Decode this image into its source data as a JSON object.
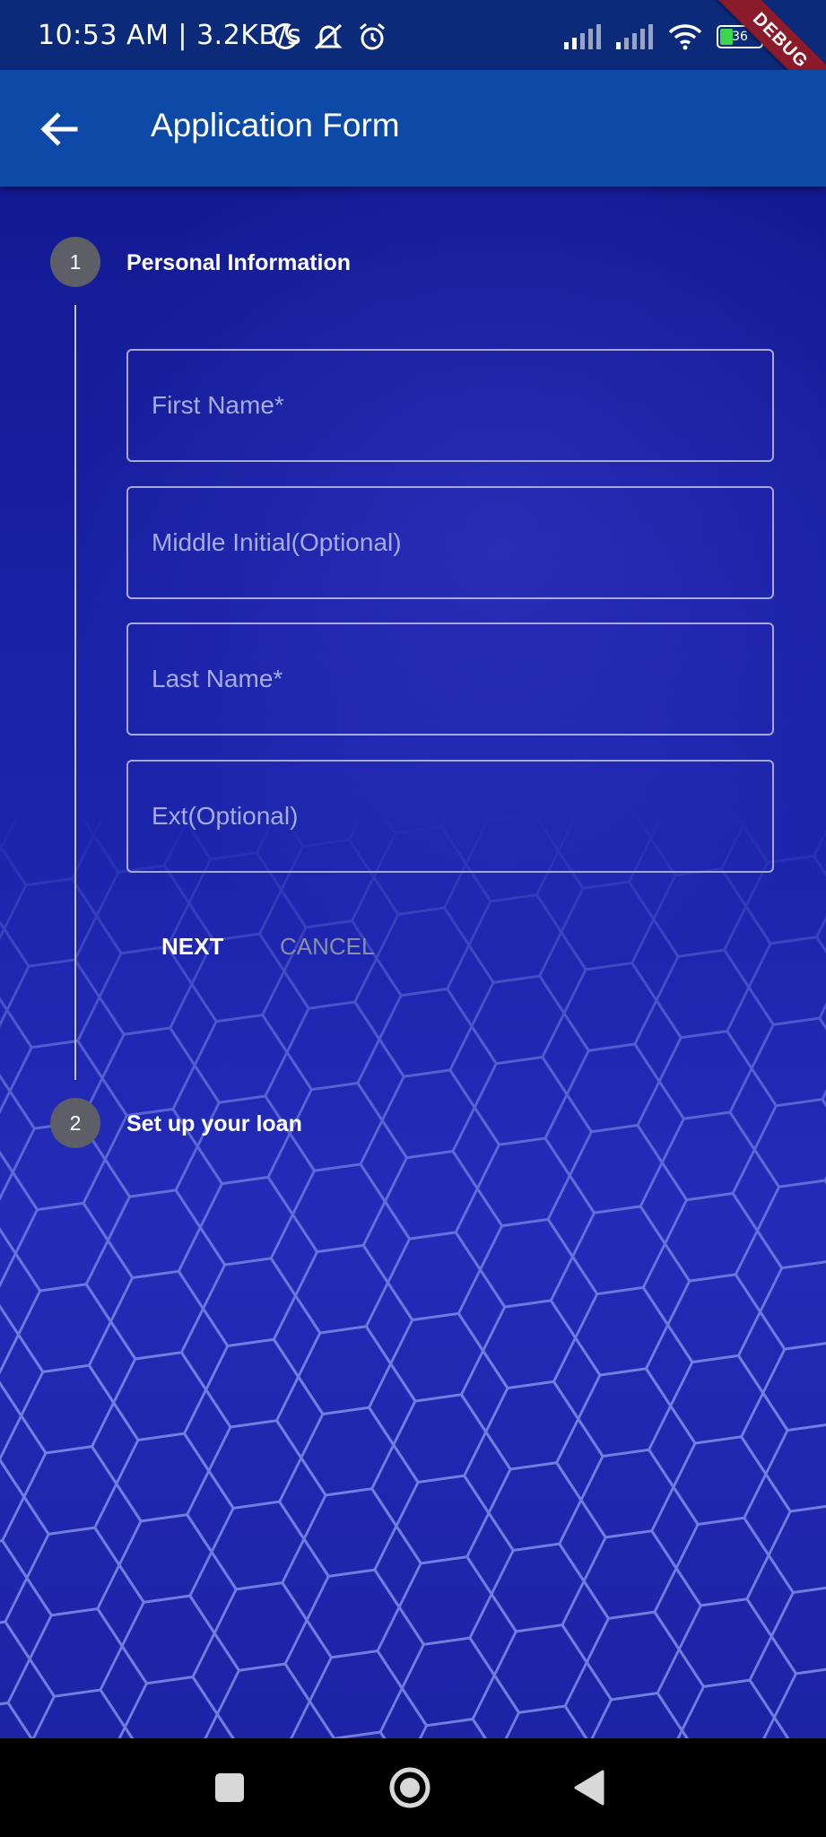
{
  "status_bar": {
    "time": "10:53 AM | 3.2KB/s",
    "battery_level": "36",
    "debug_label": "DEBUG",
    "icons": [
      "moon-icon",
      "mute-icon",
      "alarm-icon",
      "signal-icon",
      "signal-icon",
      "wifi-icon",
      "battery-icon"
    ]
  },
  "app_bar": {
    "title": "Application Form",
    "back_icon": "arrow-left-icon"
  },
  "stepper": {
    "steps": [
      {
        "number": "1",
        "title": "Personal Information"
      },
      {
        "number": "2",
        "title": "Set up your loan"
      }
    ],
    "fields": [
      {
        "placeholder": "First Name*",
        "value": ""
      },
      {
        "placeholder": "Middle Initial(Optional)",
        "value": ""
      },
      {
        "placeholder": "Last Name*",
        "value": ""
      },
      {
        "placeholder": "Ext(Optional)",
        "value": ""
      }
    ],
    "next_label": "NEXT",
    "cancel_label": "CANCEL"
  },
  "nav_bar": {
    "icons": [
      "square-recents-icon",
      "circle-home-icon",
      "triangle-back-icon"
    ]
  },
  "colors": {
    "app_bar": "#0d4aa8",
    "status_bar": "#0c2a7a",
    "background": "#1a22a8",
    "step_circle": "#5e5e67"
  }
}
